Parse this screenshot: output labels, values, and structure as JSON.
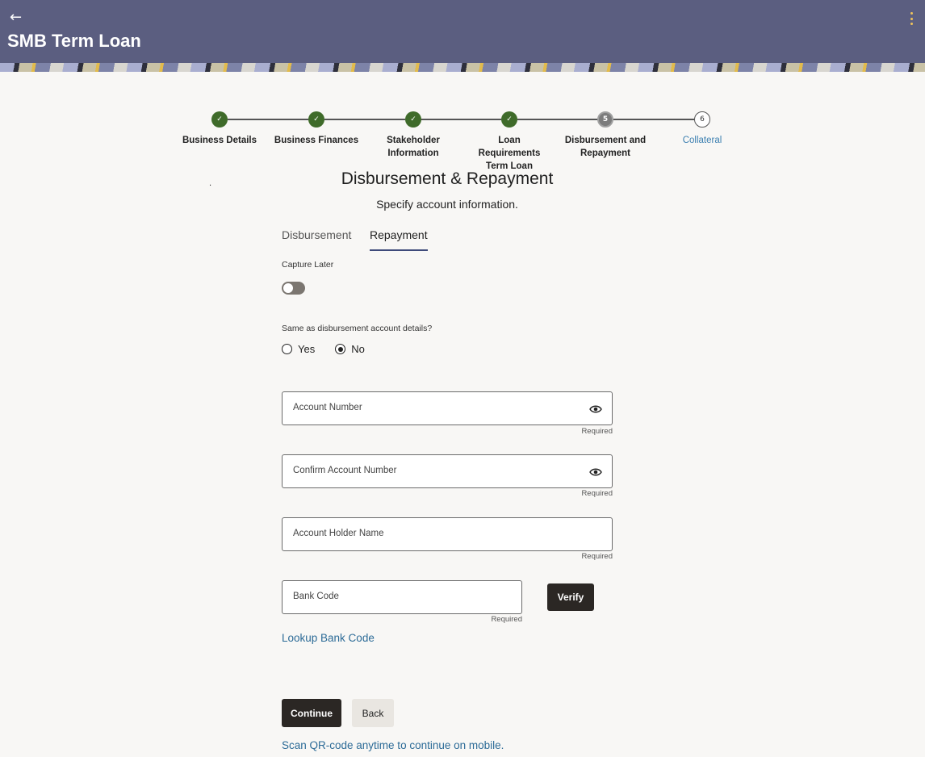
{
  "header": {
    "title": "SMB Term Loan",
    "back_icon": "back-arrow-icon",
    "menu_icon": "kebab-menu-icon",
    "accent": "#5b5e80"
  },
  "stepper": {
    "steps": [
      {
        "label": "Business Details",
        "number": "1",
        "status": "done"
      },
      {
        "label": "Business Finances",
        "number": "2",
        "status": "done"
      },
      {
        "label": "Stakeholder Information",
        "number": "3",
        "status": "done"
      },
      {
        "label": "Loan Requirements Term Loan",
        "number": "4",
        "status": "done"
      },
      {
        "label": "Disbursement and Repayment",
        "number": "5",
        "status": "current"
      },
      {
        "label": "Collateral",
        "number": "6",
        "status": "todo"
      }
    ],
    "done_color": "#3f6b2a"
  },
  "page": {
    "dot": ".",
    "title": "Disbursement & Repayment",
    "subtitle": "Specify account information."
  },
  "tabs": {
    "disbursement": "Disbursement",
    "repayment": "Repayment",
    "active": "Repayment"
  },
  "form": {
    "capture_later_label": "Capture Later",
    "capture_later_on": false,
    "same_as_label": "Same as disbursement account details?",
    "yes_label": "Yes",
    "no_label": "No",
    "selected": "No",
    "account_number_placeholder": "Account Number",
    "confirm_account_placeholder": "Confirm Account Number",
    "holder_name_placeholder": "Account Holder Name",
    "bank_code_placeholder": "Bank Code",
    "required_text": "Required",
    "verify_label": "Verify",
    "lookup_link": "Lookup Bank Code"
  },
  "footer": {
    "continue_label": "Continue",
    "back_label": "Back",
    "qr_link": "Scan QR-code anytime to continue on mobile."
  }
}
